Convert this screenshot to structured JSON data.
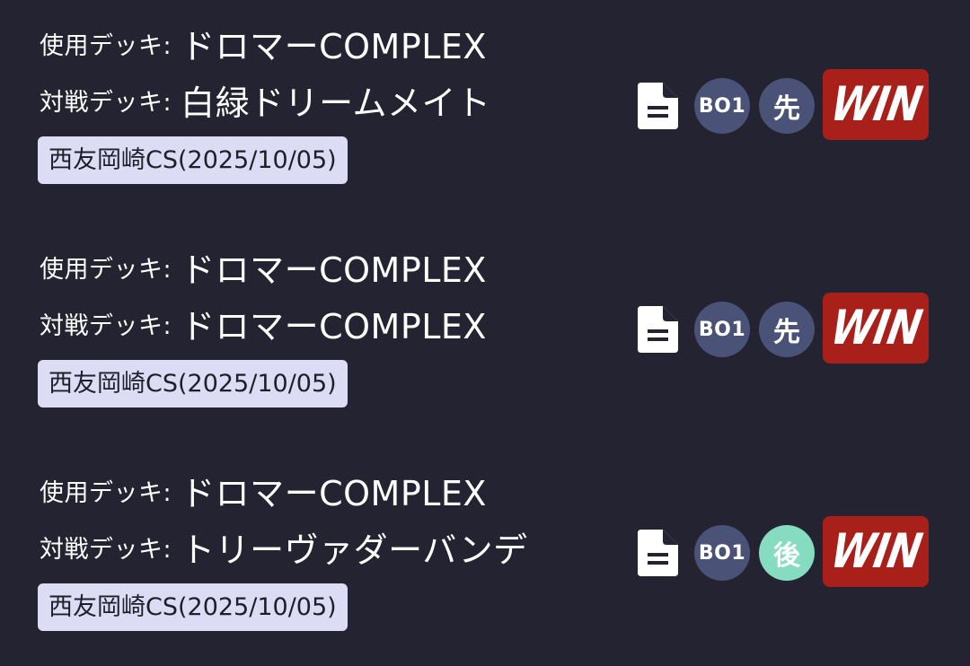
{
  "colors": {
    "background": "#232331",
    "event_chip": "#dcdcf5",
    "bo_badge": "#4a5277",
    "first_badge": "#4a5277",
    "second_badge": "#86dcc0",
    "win_badge": "#a9201b"
  },
  "matches": [
    {
      "used_label": "使用デッキ:",
      "used_deck": "ドロマーCOMPLEX",
      "opp_label": "対戦デッキ:",
      "opp_deck": "白緑ドリームメイト",
      "event": "西友岡崎CS(2025/10/05)",
      "icon": "document-icon",
      "best_of": "BO1",
      "turn_order": "先",
      "result": "WIN"
    },
    {
      "used_label": "使用デッキ:",
      "used_deck": "ドロマーCOMPLEX",
      "opp_label": "対戦デッキ:",
      "opp_deck": "ドロマーCOMPLEX",
      "event": "西友岡崎CS(2025/10/05)",
      "icon": "document-icon",
      "best_of": "BO1",
      "turn_order": "先",
      "result": "WIN"
    },
    {
      "used_label": "使用デッキ:",
      "used_deck": "ドロマーCOMPLEX",
      "opp_label": "対戦デッキ:",
      "opp_deck": "トリーヴァダーバンデ",
      "event": "西友岡崎CS(2025/10/05)",
      "icon": "document-icon",
      "best_of": "BO1",
      "turn_order": "後",
      "result": "WIN"
    }
  ]
}
